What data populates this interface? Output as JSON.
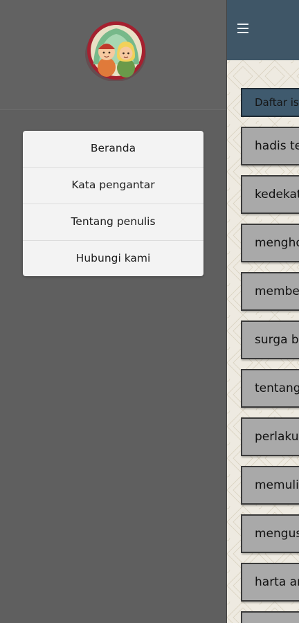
{
  "drawer": {
    "menu_items": [
      {
        "label": "Beranda"
      },
      {
        "label": "Kata pengantar"
      },
      {
        "label": "Tentang penulis"
      },
      {
        "label": "Hubungi kami"
      }
    ]
  },
  "main": {
    "header_label": "Daftar isi",
    "topics": [
      {
        "label": "hadis tentang"
      },
      {
        "label": "kedekatan"
      },
      {
        "label": "menghormati"
      },
      {
        "label": "memberi"
      },
      {
        "label": "surga bagi"
      },
      {
        "label": "tentang"
      },
      {
        "label": "perlakuan"
      },
      {
        "label": "memuliakan"
      },
      {
        "label": "mengusap"
      },
      {
        "label": "harta anak"
      }
    ]
  },
  "icons": {
    "menu": "hamburger-icon",
    "avatar": "kids-avatar-icon"
  },
  "colors": {
    "drawer_bg": "#5f5f5f",
    "appbar": "#3f5667",
    "topic_button": "#a9a9a9",
    "avatar_ring": "#a5202f"
  }
}
